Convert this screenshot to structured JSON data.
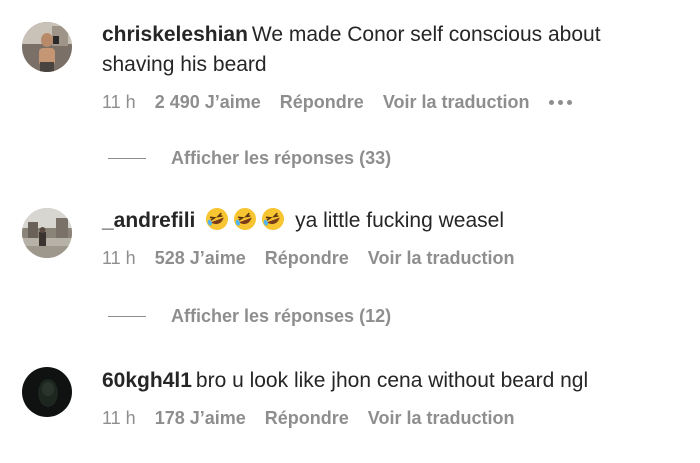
{
  "comments": [
    {
      "username": "chriskeleshian",
      "text": "We made Conor self conscious about shaving his beard",
      "time": "11 h",
      "likes": "2 490 J’aime",
      "reply": "Répondre",
      "translate": "Voir la traduction",
      "view_replies": "Afficher les réponses (33)"
    },
    {
      "username": "_andrefili",
      "emojis": [
        "rolling-on-floor-laughing",
        "rolling-on-floor-laughing",
        "rolling-on-floor-laughing"
      ],
      "text": "ya little fucking weasel",
      "time": "11 h",
      "likes": "528 J’aime",
      "reply": "Répondre",
      "translate": "Voir la traduction",
      "view_replies": "Afficher les réponses (12)"
    },
    {
      "username": "60kgh4l1",
      "text": "bro u look like jhon cena without beard ngl",
      "time": "11 h",
      "likes": "178 J’aime",
      "reply": "Répondre",
      "translate": "Voir la traduction"
    }
  ],
  "colors": {
    "text": "#262626",
    "secondary": "#8e8e8e",
    "background": "#ffffff"
  }
}
